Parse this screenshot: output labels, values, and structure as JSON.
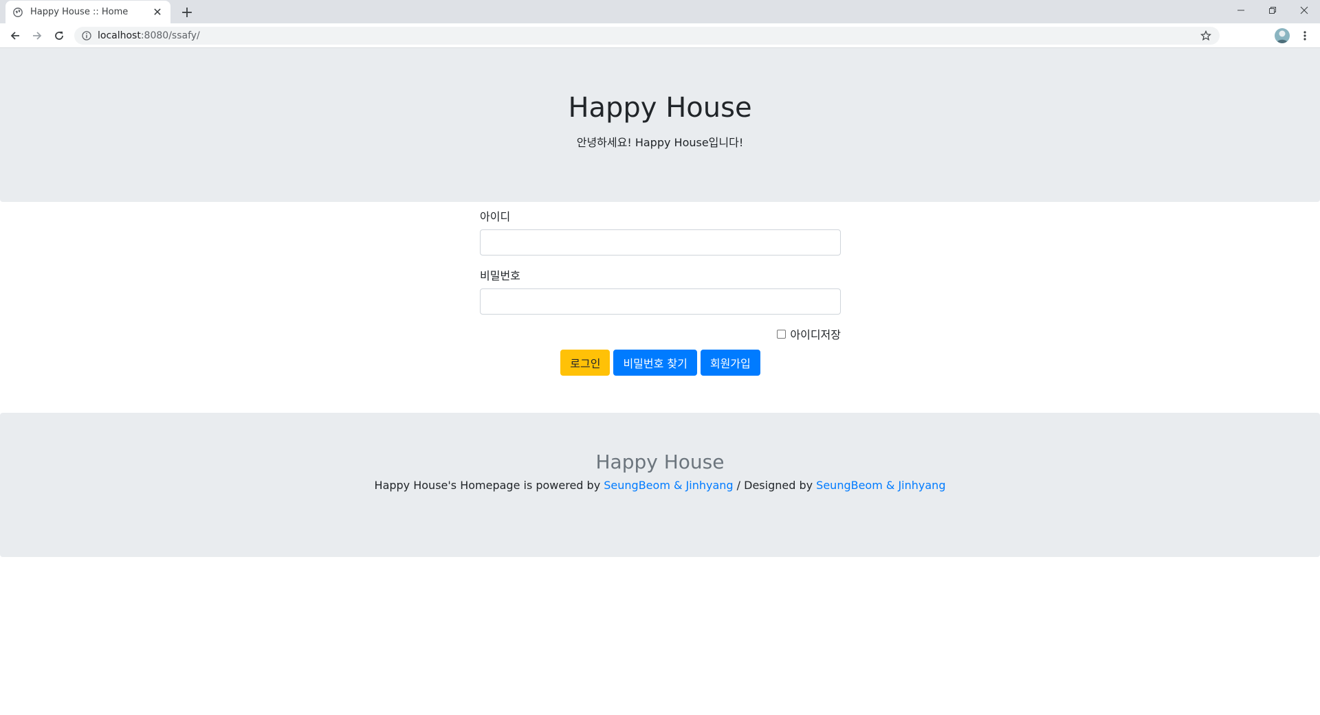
{
  "browser": {
    "tab_title": "Happy House :: Home",
    "url_host": "localhost",
    "url_path": ":8080/ssafy/",
    "icons": [
      "globe-icon",
      "close-icon",
      "plus-icon",
      "back-icon",
      "forward-icon",
      "reload-icon",
      "info-icon",
      "star-icon",
      "menu-icon",
      "minimize-icon",
      "restore-icon"
    ]
  },
  "hero": {
    "title": "Happy House",
    "subtitle": "안녕하세요! Happy House입니다!"
  },
  "login_form": {
    "id_label": "아이디",
    "id_value": "",
    "password_label": "비밀번호",
    "password_value": "",
    "remember_label": "아이디저장",
    "remember_checked": false,
    "login_button": "로그인",
    "find_password_button": "비밀번호 찾기",
    "signup_button": "회원가입"
  },
  "footer": {
    "title": "Happy House",
    "text_prefix": "Happy House's Homepage is powered by ",
    "powered_by_link": "SeungBeom & Jinhyang",
    "text_middle": " / Designed by ",
    "designed_by_link": "SeungBeom & Jinhyang"
  },
  "colors": {
    "jumbotron_bg": "#e9ecef",
    "warning": "#ffc107",
    "primary": "#007bff",
    "link": "#007bff",
    "muted": "#6c757d"
  }
}
